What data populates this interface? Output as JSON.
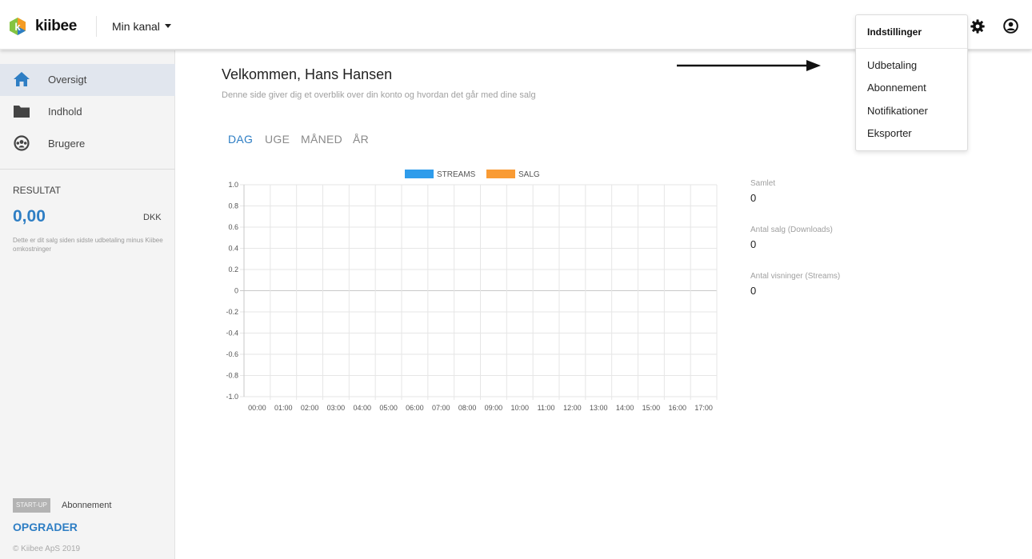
{
  "header": {
    "logo_text": "kiibee",
    "logo_letter": "k",
    "channel_label": "Min kanal",
    "brand_colors": {
      "green": "#84c441",
      "orange": "#f49b23",
      "blue": "#2e7ec4"
    },
    "icons": {
      "settings": "gear-icon",
      "profile": "user-circle-icon"
    }
  },
  "settings_menu": {
    "header": "Indstillinger",
    "items": [
      {
        "label": "Udbetaling"
      },
      {
        "label": "Abonnement"
      },
      {
        "label": "Notifikationer"
      },
      {
        "label": "Eksporter"
      }
    ]
  },
  "sidebar": {
    "nav": [
      {
        "label": "Oversigt",
        "icon": "home-icon",
        "active": true
      },
      {
        "label": "Indhold",
        "icon": "folder-icon",
        "active": false
      },
      {
        "label": "Brugere",
        "icon": "users-icon",
        "active": false
      }
    ],
    "result": {
      "title": "RESULTAT",
      "value": "0,00",
      "currency": "DKK",
      "note": "Dette er dit salg siden sidste udbetaling minus Kiibee omkostninger"
    },
    "plan_badge": "START-UP",
    "plan_label": "Abonnement",
    "upgrade_label": "OPGRADER",
    "copyright": "© Kiibee ApS 2019"
  },
  "main": {
    "welcome": "Velkommen, Hans Hansen",
    "subtitle": "Denne side giver dig et overblik over din konto og hvordan det går med dine salg",
    "tabs": [
      {
        "label": "DAG",
        "active": true
      },
      {
        "label": "UGE",
        "active": false
      },
      {
        "label": "MÅNED",
        "active": false
      },
      {
        "label": "ÅR",
        "active": false
      }
    ],
    "stats": [
      {
        "label": "Samlet",
        "value": "0"
      },
      {
        "label": "Antal salg (Downloads)",
        "value": "0"
      },
      {
        "label": "Antal visninger (Streams)",
        "value": "0"
      }
    ]
  },
  "chart_data": {
    "type": "line",
    "x": [
      "00:00",
      "01:00",
      "02:00",
      "03:00",
      "04:00",
      "05:00",
      "06:00",
      "07:00",
      "08:00",
      "09:00",
      "10:00",
      "11:00",
      "12:00",
      "13:00",
      "14:00",
      "15:00",
      "16:00",
      "17:00"
    ],
    "y_ticks": [
      "1.0",
      "0.8",
      "0.6",
      "0.4",
      "0.2",
      "0",
      "-0.2",
      "-0.4",
      "-0.6",
      "-0.8",
      "-1.0"
    ],
    "ylim": [
      -1.0,
      1.0
    ],
    "grid": true,
    "legend_position": "top-center",
    "series": [
      {
        "name": "STREAMS",
        "color": "#2f9ceb",
        "values": []
      },
      {
        "name": "SALG",
        "color": "#f99b34",
        "values": []
      }
    ]
  }
}
